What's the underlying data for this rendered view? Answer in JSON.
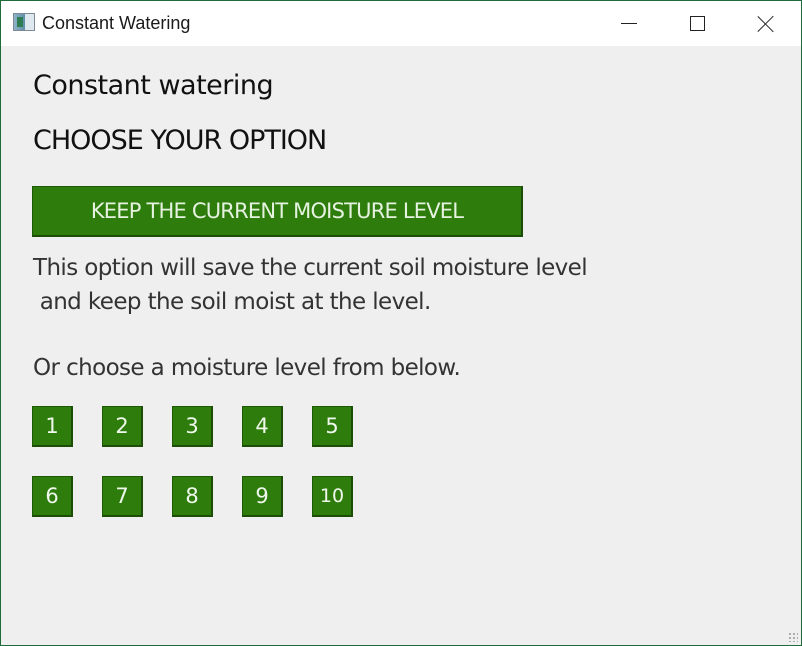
{
  "window": {
    "title": "Constant Watering"
  },
  "titlebar": {
    "icons": {
      "app": "app-window-icon",
      "minimize": "minimize-icon",
      "maximize": "maximize-icon",
      "close": "close-icon"
    }
  },
  "main": {
    "heading": "Constant watering",
    "subheading": "CHOOSE YOUR OPTION",
    "keep_button_label": "KEEP THE CURRENT MOISTURE LEVEL",
    "description": "This option will save the current soil moisture level\n and keep the soil moist at the level.",
    "prompt": "Or choose a moisture level from below.",
    "levels": [
      "1",
      "2",
      "3",
      "4",
      "5",
      "6",
      "7",
      "8",
      "9",
      "10"
    ]
  },
  "colors": {
    "button_green": "#2e7d0c",
    "background": "#efefef"
  }
}
